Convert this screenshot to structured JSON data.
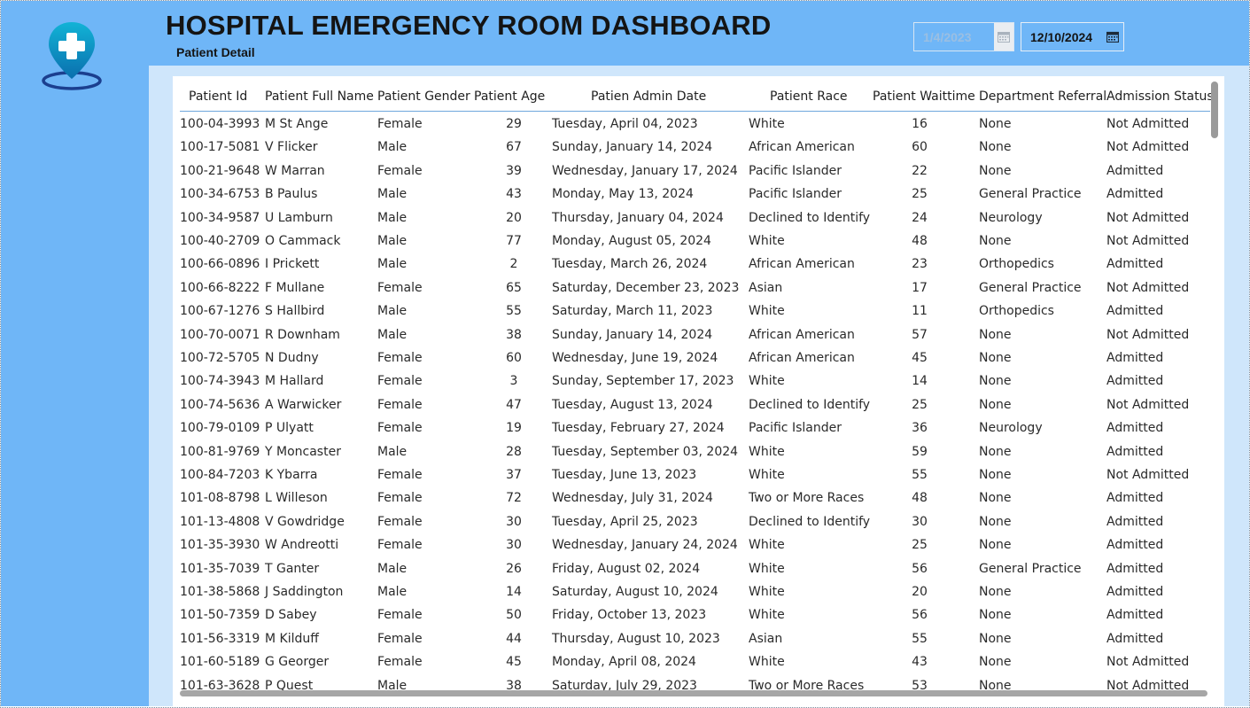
{
  "header": {
    "title": "HOSPITAL EMERGENCY ROOM DASHBOARD",
    "subtitle": "Patient Detail"
  },
  "date_range": {
    "start": "1/4/2023",
    "end": "12/10/2024",
    "icon": "calendar-icon"
  },
  "logo": {
    "icon": "medical-location-pin-icon",
    "colors": [
      "#0aa5c8",
      "#1b3f8f"
    ]
  },
  "colors": {
    "header_bg": "#6fb6f7",
    "content_bg": "#cfe6fb",
    "accent_line": "#6fa7dc"
  },
  "table": {
    "columns": [
      "Patient Id",
      "Patient Full Name",
      "Patient Gender",
      "Patient Age",
      "Patien Admin Date",
      "Patient Race",
      "Patient Waittime",
      "Department Referral",
      "Admission Status"
    ],
    "rows": [
      [
        "100-04-3993",
        "M St Ange",
        "Female",
        "29",
        "Tuesday, April 04, 2023",
        "White",
        "16",
        "None",
        "Not Admitted"
      ],
      [
        "100-17-5081",
        "V Flicker",
        "Male",
        "67",
        "Sunday, January 14, 2024",
        "African American",
        "60",
        "None",
        "Not Admitted"
      ],
      [
        "100-21-9648",
        "W Marran",
        "Female",
        "39",
        "Wednesday, January 17, 2024",
        "Pacific Islander",
        "22",
        "None",
        "Admitted"
      ],
      [
        "100-34-6753",
        "B Paulus",
        "Male",
        "43",
        "Monday, May 13, 2024",
        "Pacific Islander",
        "25",
        "General Practice",
        "Admitted"
      ],
      [
        "100-34-9587",
        "U Lamburn",
        "Male",
        "20",
        "Thursday, January 04, 2024",
        "Declined to Identify",
        "24",
        "Neurology",
        "Not Admitted"
      ],
      [
        "100-40-2709",
        "O Cammack",
        "Male",
        "77",
        "Monday, August 05, 2024",
        "White",
        "48",
        "None",
        "Not Admitted"
      ],
      [
        "100-66-0896",
        "I Prickett",
        "Male",
        "2",
        "Tuesday, March 26, 2024",
        "African American",
        "23",
        "Orthopedics",
        "Admitted"
      ],
      [
        "100-66-8222",
        "F Mullane",
        "Female",
        "65",
        "Saturday, December 23, 2023",
        "Asian",
        "17",
        "General Practice",
        "Not Admitted"
      ],
      [
        "100-67-1276",
        "S Hallbird",
        "Male",
        "55",
        "Saturday, March 11, 2023",
        "White",
        "11",
        "Orthopedics",
        "Admitted"
      ],
      [
        "100-70-0071",
        "R Downham",
        "Male",
        "38",
        "Sunday, January 14, 2024",
        "African American",
        "57",
        "None",
        "Not Admitted"
      ],
      [
        "100-72-5705",
        "N Dudny",
        "Female",
        "60",
        "Wednesday, June 19, 2024",
        "African American",
        "45",
        "None",
        "Admitted"
      ],
      [
        "100-74-3943",
        "M Hallard",
        "Female",
        "3",
        "Sunday, September 17, 2023",
        "White",
        "14",
        "None",
        "Admitted"
      ],
      [
        "100-74-5636",
        "A Warwicker",
        "Female",
        "47",
        "Tuesday, August 13, 2024",
        "Declined to Identify",
        "25",
        "None",
        "Not Admitted"
      ],
      [
        "100-79-0109",
        "P Ulyatt",
        "Female",
        "19",
        "Tuesday, February 27, 2024",
        "Pacific Islander",
        "36",
        "Neurology",
        "Admitted"
      ],
      [
        "100-81-9769",
        "Y Moncaster",
        "Male",
        "28",
        "Tuesday, September 03, 2024",
        "White",
        "59",
        "None",
        "Admitted"
      ],
      [
        "100-84-7203",
        "K Ybarra",
        "Female",
        "37",
        "Tuesday, June 13, 2023",
        "White",
        "55",
        "None",
        "Not Admitted"
      ],
      [
        "101-08-8798",
        "L Willeson",
        "Female",
        "72",
        "Wednesday, July 31, 2024",
        "Two or More Races",
        "48",
        "None",
        "Admitted"
      ],
      [
        "101-13-4808",
        "V Gowdridge",
        "Female",
        "30",
        "Tuesday, April 25, 2023",
        "Declined to Identify",
        "30",
        "None",
        "Admitted"
      ],
      [
        "101-35-3930",
        "W Andreotti",
        "Female",
        "30",
        "Wednesday, January 24, 2024",
        "White",
        "25",
        "None",
        "Admitted"
      ],
      [
        "101-35-7039",
        "T Ganter",
        "Male",
        "26",
        "Friday, August 02, 2024",
        "White",
        "56",
        "General Practice",
        "Admitted"
      ],
      [
        "101-38-5868",
        "J Saddington",
        "Male",
        "14",
        "Saturday, August 10, 2024",
        "White",
        "20",
        "None",
        "Admitted"
      ],
      [
        "101-50-7359",
        "D Sabey",
        "Female",
        "50",
        "Friday, October 13, 2023",
        "White",
        "56",
        "None",
        "Admitted"
      ],
      [
        "101-56-3319",
        "M Kilduff",
        "Female",
        "44",
        "Thursday, August 10, 2023",
        "Asian",
        "55",
        "None",
        "Admitted"
      ],
      [
        "101-60-5189",
        "G Georger",
        "Female",
        "45",
        "Monday, April 08, 2024",
        "White",
        "43",
        "None",
        "Not Admitted"
      ],
      [
        "101-63-3628",
        "P Quest",
        "Male",
        "38",
        "Saturday, July 29, 2023",
        "Two or More Races",
        "53",
        "None",
        "Not Admitted"
      ]
    ]
  }
}
